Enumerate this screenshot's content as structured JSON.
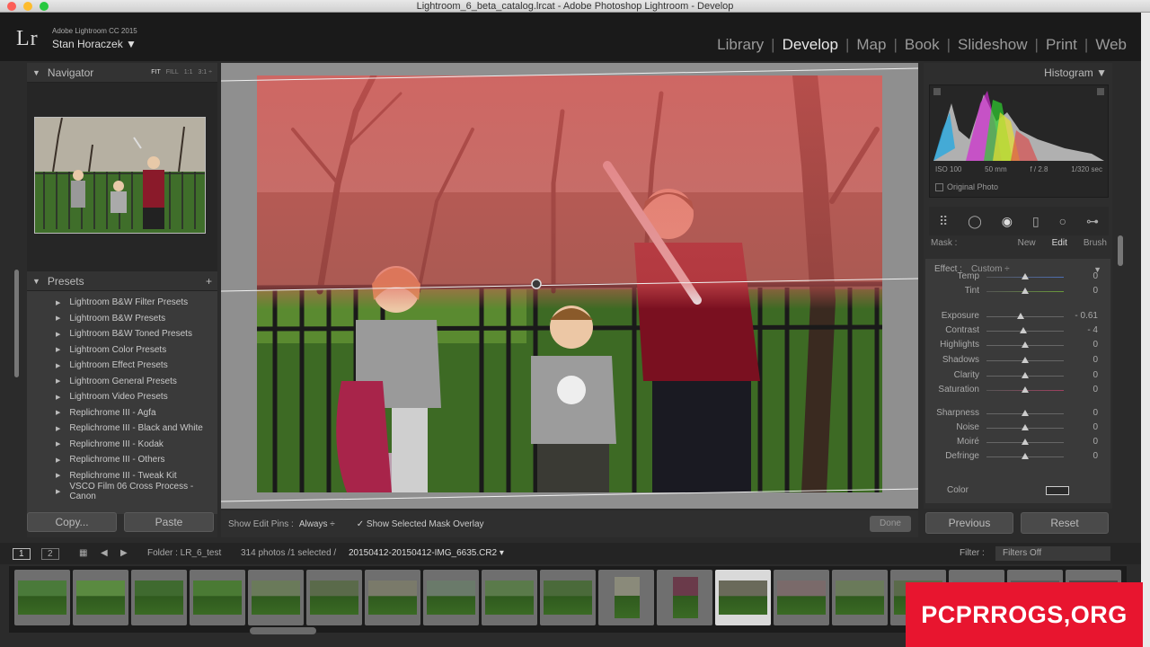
{
  "window": {
    "title": "Lightroom_6_beta_catalog.lrcat - Adobe Photoshop Lightroom - Develop"
  },
  "identity": {
    "logo": "Lr",
    "product": "Adobe Lightroom CC 2015",
    "user": "Stan Horaczek ▼"
  },
  "modules": [
    "Library",
    "Develop",
    "Map",
    "Book",
    "Slideshow",
    "Print",
    "Web"
  ],
  "navigator": {
    "title": "Navigator",
    "zoom": [
      "FIT",
      "FILL",
      "1:1",
      "3:1 ÷"
    ]
  },
  "presets": {
    "title": "Presets",
    "add": "+",
    "items": [
      "Lightroom B&W Filter Presets",
      "Lightroom B&W Presets",
      "Lightroom B&W Toned Presets",
      "Lightroom Color Presets",
      "Lightroom Effect Presets",
      "Lightroom General Presets",
      "Lightroom Video Presets",
      "Replichrome III - Agfa",
      "Replichrome III - Black and White",
      "Replichrome III - Kodak",
      "Replichrome III - Others",
      "Replichrome III - Tweak Kit",
      "VSCO Film 06 Cross Process - Canon"
    ]
  },
  "left_buttons": {
    "copy": "Copy...",
    "paste": "Paste"
  },
  "toolbar": {
    "show_pins_label": "Show Edit Pins :",
    "show_pins_value": "Always ÷",
    "overlay_label": "✓  Show Selected Mask Overlay",
    "done": "Done"
  },
  "histogram": {
    "title": "Histogram ▼",
    "exif": [
      "ISO 100",
      "50 mm",
      "f / 2.8",
      "1/320 sec"
    ],
    "original_photo": "Original Photo"
  },
  "mask": {
    "label": "Mask :",
    "new": "New",
    "edit": "Edit",
    "brush": "Brush"
  },
  "effect": {
    "label": "Effect :",
    "value": "Custom ÷"
  },
  "sliders": [
    {
      "name": "Temp",
      "value": "0",
      "pos": 0.5,
      "color": "#4d6fb5"
    },
    {
      "name": "Tint",
      "value": "0",
      "pos": 0.5,
      "color": "#6a9a3a"
    },
    {
      "name": "Exposure",
      "value": "- 0.61",
      "pos": 0.44,
      "color": ""
    },
    {
      "name": "Contrast",
      "value": "- 4",
      "pos": 0.48,
      "color": ""
    },
    {
      "name": "Highlights",
      "value": "0",
      "pos": 0.5,
      "color": ""
    },
    {
      "name": "Shadows",
      "value": "0",
      "pos": 0.5,
      "color": ""
    },
    {
      "name": "Clarity",
      "value": "0",
      "pos": 0.5,
      "color": ""
    },
    {
      "name": "Saturation",
      "value": "0",
      "pos": 0.5,
      "color": "#a04060"
    },
    {
      "name": "Sharpness",
      "value": "0",
      "pos": 0.5,
      "color": ""
    },
    {
      "name": "Noise",
      "value": "0",
      "pos": 0.5,
      "color": ""
    },
    {
      "name": "Moiré",
      "value": "0",
      "pos": 0.5,
      "color": ""
    },
    {
      "name": "Defringe",
      "value": "0",
      "pos": 0.5,
      "color": ""
    }
  ],
  "color_label": "Color",
  "right_buttons": {
    "previous": "Previous",
    "reset": "Reset"
  },
  "filmbar": {
    "view1": "1",
    "view2": "2",
    "folder": "Folder : LR_6_test",
    "count": "314 photos /1 selected /",
    "filename": "20150412-20150412-IMG_6635.CR2 ▾",
    "filter_label": "Filter :",
    "filter_value": "Filters Off"
  },
  "watermark": "PCPRROGS,ORG",
  "colors": {
    "accent": "#e8152f",
    "mask_overlay": "#e06a6a"
  }
}
